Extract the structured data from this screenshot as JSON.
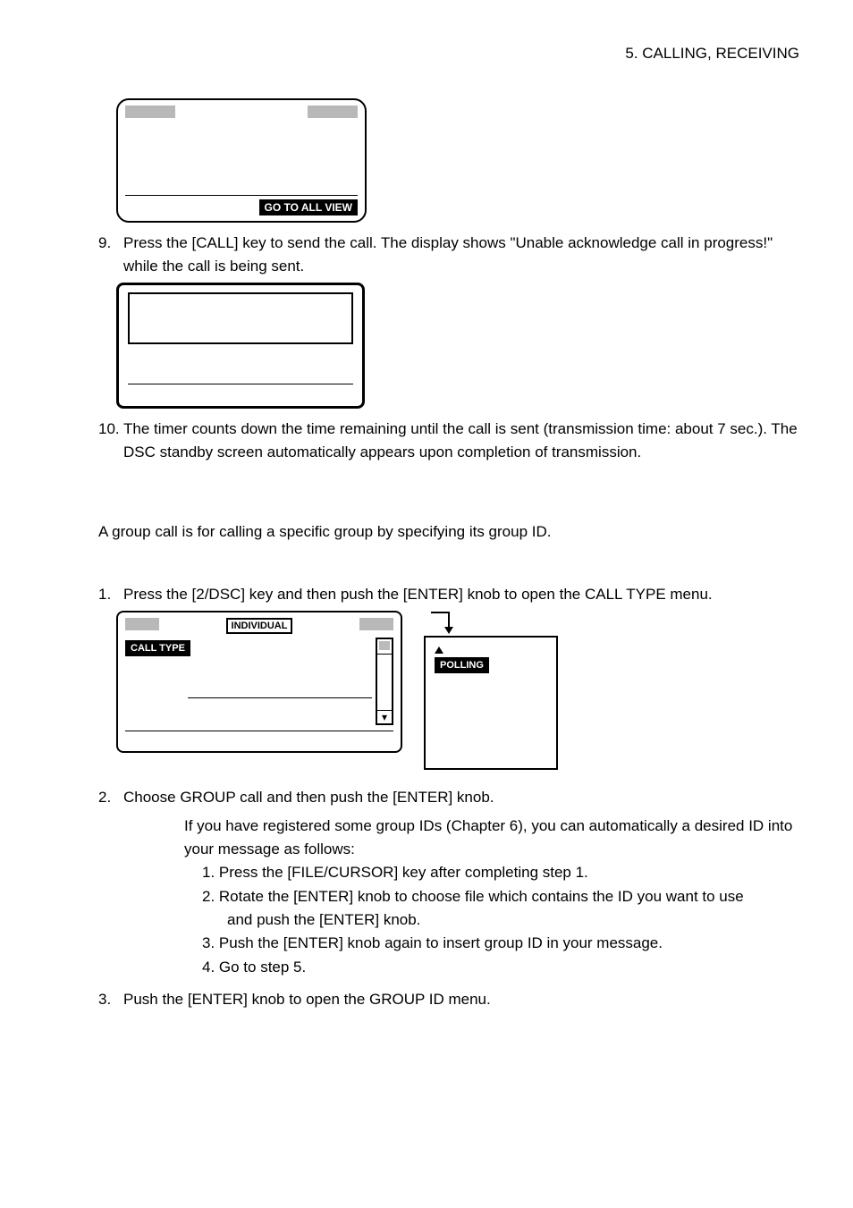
{
  "header": {
    "section": "5.  CALLING,  RECEIVING"
  },
  "box1": {
    "button": "GO TO ALL VIEW"
  },
  "step9": {
    "num": "9.",
    "text": "Press the [CALL] key to send the call. The display shows \"Unable acknowledge call in progress!\" while the call is being sent."
  },
  "step10": {
    "num": "10.",
    "text": "The timer counts down the time remaining until the call is sent (transmission time: about 7 sec.). The DSC standby screen automatically appears upon completion of transmission."
  },
  "group_intro": "A group call is for calling a specific group by specifying its group ID.",
  "step1": {
    "num": "1.",
    "text": "Press the [2/DSC] key and then push the [ENTER] knob to open the CALL TYPE menu."
  },
  "panel_a": {
    "individual": "INDIVIDUAL",
    "call_type": "CALL TYPE"
  },
  "panel_b": {
    "polling": "POLLING"
  },
  "step2": {
    "num": "2.",
    "text": "Choose GROUP call and then push the [ENTER] knob."
  },
  "note_block": {
    "lead": "If you have registered some group IDs (Chapter 6), you can automatically a desired ID into your message as follows:",
    "l1": "1. Press the [FILE/CURSOR] key after completing step 1.",
    "l2": "2. Rotate the [ENTER] knob to choose file which contains the ID you want to use",
    "l2b": "and push the [ENTER] knob.",
    "l3": "3. Push the [ENTER] knob again to insert group ID in your message.",
    "l4": "4. Go to step 5."
  },
  "step3": {
    "num": "3.",
    "text": "Push the [ENTER] knob to open the GROUP ID menu."
  }
}
